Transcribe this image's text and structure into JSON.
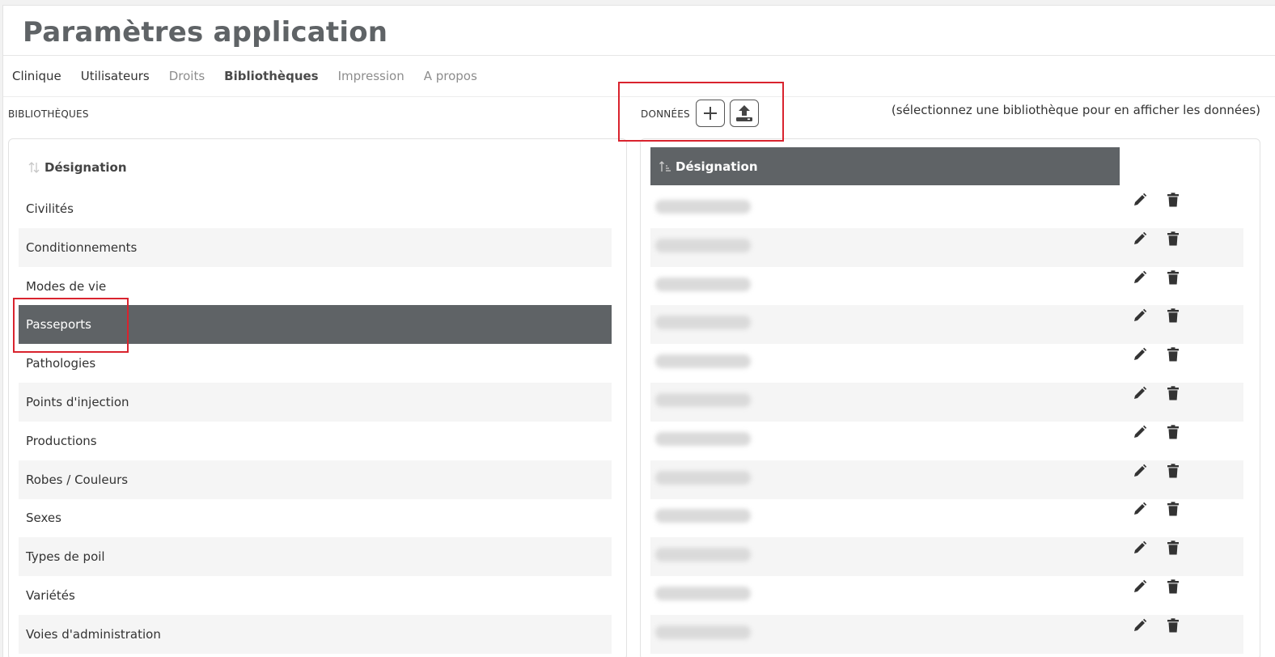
{
  "page": {
    "title": "Paramètres application"
  },
  "tabs": [
    {
      "label": "Clinique",
      "state": "normal"
    },
    {
      "label": "Utilisateurs",
      "state": "normal"
    },
    {
      "label": "Droits",
      "state": "muted"
    },
    {
      "label": "Bibliothèques",
      "state": "active"
    },
    {
      "label": "Impression",
      "state": "muted"
    },
    {
      "label": "A propos",
      "state": "muted"
    }
  ],
  "libraries": {
    "section_label": "BIBLIOTHÈQUES",
    "column_header": "Désignation",
    "selected": "Passeports",
    "items": [
      "Civilités",
      "Conditionnements",
      "Modes de vie",
      "Passeports",
      "Pathologies",
      "Points d'injection",
      "Productions",
      "Robes / Couleurs",
      "Sexes",
      "Types de poil",
      "Variétés",
      "Voies d'administration"
    ]
  },
  "data": {
    "section_label": "DONNÉES",
    "hint": "(sélectionnez une bibliothèque pour en afficher les données)",
    "column_header": "Désignation",
    "add_icon": "plus-icon",
    "import_icon": "upload-icon",
    "row_actions": [
      "pencil-icon",
      "trash-icon"
    ],
    "blurred_row_count": 12
  },
  "colors": {
    "header_bg": "#5f6366",
    "highlight_border": "#d9232e",
    "row_alt": "#f5f5f5"
  }
}
